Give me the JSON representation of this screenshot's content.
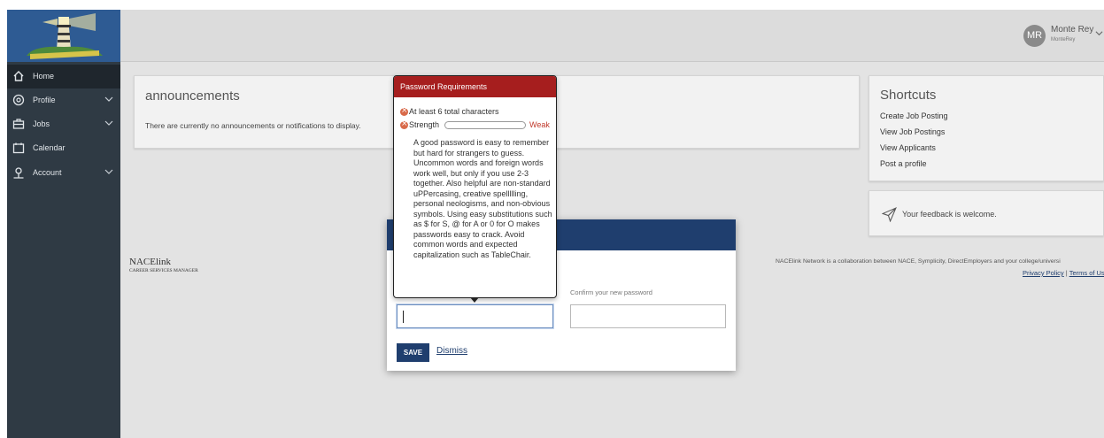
{
  "user": {
    "initials": "MR",
    "name": "Monte Rey",
    "username": "MonteRey"
  },
  "sidebar": {
    "items": [
      {
        "label": "Home",
        "icon": "home-icon",
        "has_submenu": false,
        "active": true
      },
      {
        "label": "Profile",
        "icon": "profile-icon",
        "has_submenu": true,
        "active": false
      },
      {
        "label": "Jobs",
        "icon": "jobs-icon",
        "has_submenu": true,
        "active": false
      },
      {
        "label": "Calendar",
        "icon": "calendar-icon",
        "has_submenu": false,
        "active": false
      },
      {
        "label": "Account",
        "icon": "account-icon",
        "has_submenu": true,
        "active": false
      }
    ]
  },
  "announcements": {
    "title": "announcements",
    "empty_text": "There are currently no announcements or notifications to display."
  },
  "shortcuts": {
    "title": "Shortcuts",
    "links": [
      "Create Job Posting",
      "View Job Postings",
      "View Applicants",
      "Post a profile"
    ]
  },
  "feedback": {
    "text": "Your feedback is welcome."
  },
  "footer": {
    "brand_name": "NACElink",
    "brand_tagline": "CAREER SERVICES MANAGER",
    "network_text": "NACElink Network is a collaboration between NACE, Symplicity, DirectEmployers and your college/universi",
    "privacy_link": "Privacy Policy",
    "separator": "|",
    "terms_link": "Terms of Us"
  },
  "modal": {
    "confirm_label": "Confirm your new password",
    "save_label": "SAVE",
    "dismiss_label": "Dismiss"
  },
  "password_popover": {
    "title": "Password Requirements",
    "requirement_length": "At least 6 total characters",
    "strength_label": "Strength",
    "strength_value": "Weak",
    "strength_fraction": 0,
    "advice": "A good password is easy to remember but hard for strangers to guess. Uncommon words and foreign words work well, but only if you use 2-3 together. Also helpful are non-standard uPPercasing, creative spellllling, personal neologisms, and non-obvious symbols. Using easy substitutions such as $ for S, @ for A or 0 for O makes passwords easy to crack. Avoid common words and expected capitalization such as TableChair."
  },
  "colors": {
    "sidebar": "#2f3a44",
    "modal_header": "#1f3e6e",
    "popover_header": "#a61e1e",
    "weak": "#c0392b"
  }
}
